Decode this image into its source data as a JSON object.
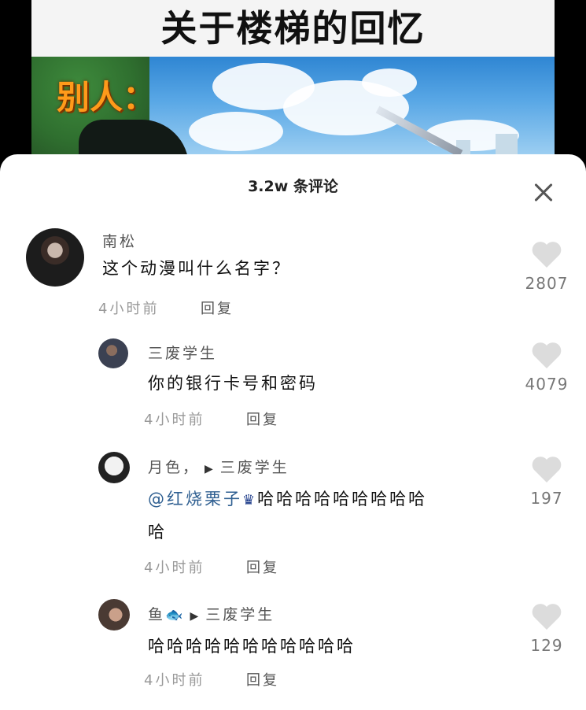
{
  "video": {
    "title": "关于楼梯的回忆",
    "scene_text": "别人："
  },
  "comments_panel": {
    "title": "3.2w 条评论",
    "close_icon": "close-icon"
  },
  "comments": [
    {
      "username": "南松",
      "text": "这个动漫叫什么名字？",
      "time": "4小时前",
      "reply_label": "回复",
      "likes": "2807"
    },
    {
      "username": "三废学生",
      "text": "你的银行卡号和密码",
      "time": "4小时前",
      "reply_label": "回复",
      "likes": "4079"
    },
    {
      "username": "月色，",
      "reply_to": "三废学生",
      "mention": "@红烧栗子",
      "text_line1": "哈哈哈哈哈哈哈哈哈",
      "text_line2": "哈",
      "time": "4小时前",
      "reply_label": "回复",
      "likes": "197"
    },
    {
      "username": "鱼",
      "reply_to": "三废学生",
      "text": "哈哈哈哈哈哈哈哈哈哈哈",
      "time": "4小时前",
      "reply_label": "回复",
      "likes": "129"
    }
  ],
  "colors": {
    "mention": "#2f5f91",
    "heart": "#dcdcdc",
    "meta": "#999999"
  }
}
